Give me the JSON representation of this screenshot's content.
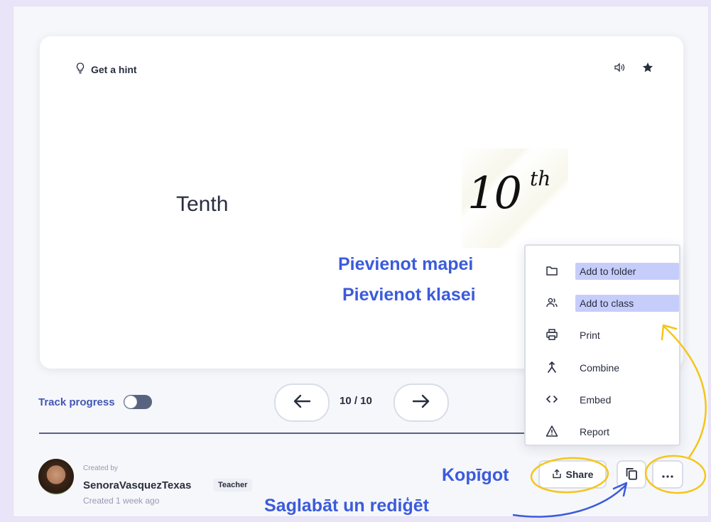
{
  "card": {
    "hint_label": "Get a hint",
    "term_text": "Tenth",
    "image_number": "10",
    "image_suffix": "th"
  },
  "controls": {
    "track_progress_label": "Track progress",
    "counter_text": "10 / 10"
  },
  "creator": {
    "created_by_label": "Created by",
    "name": "SenoraVasquezTexas",
    "role_badge": "Teacher",
    "created_ago": "Created 1 week ago"
  },
  "actions": {
    "share_label": "Share"
  },
  "menu": {
    "items": [
      {
        "label": "Add to folder",
        "icon": "folder-icon",
        "highlighted": true
      },
      {
        "label": "Add to class",
        "icon": "class-icon",
        "highlighted": true
      },
      {
        "label": "Print",
        "icon": "print-icon",
        "highlighted": false
      },
      {
        "label": "Combine",
        "icon": "combine-icon",
        "highlighted": false
      },
      {
        "label": "Embed",
        "icon": "embed-icon",
        "highlighted": false
      },
      {
        "label": "Report",
        "icon": "report-icon",
        "highlighted": false
      }
    ]
  },
  "annotations": {
    "add_to_folder": "Pievienot mapei",
    "add_to_class": "Pievienot klasei",
    "share": "Kopīgot",
    "save_edit": "Saglabāt un rediģēt"
  },
  "colors": {
    "annotation_text": "#3b5bdb",
    "annotation_stroke": "#f5c518",
    "menu_highlight": "#c7cdfa",
    "link_blue": "#4257b2"
  }
}
